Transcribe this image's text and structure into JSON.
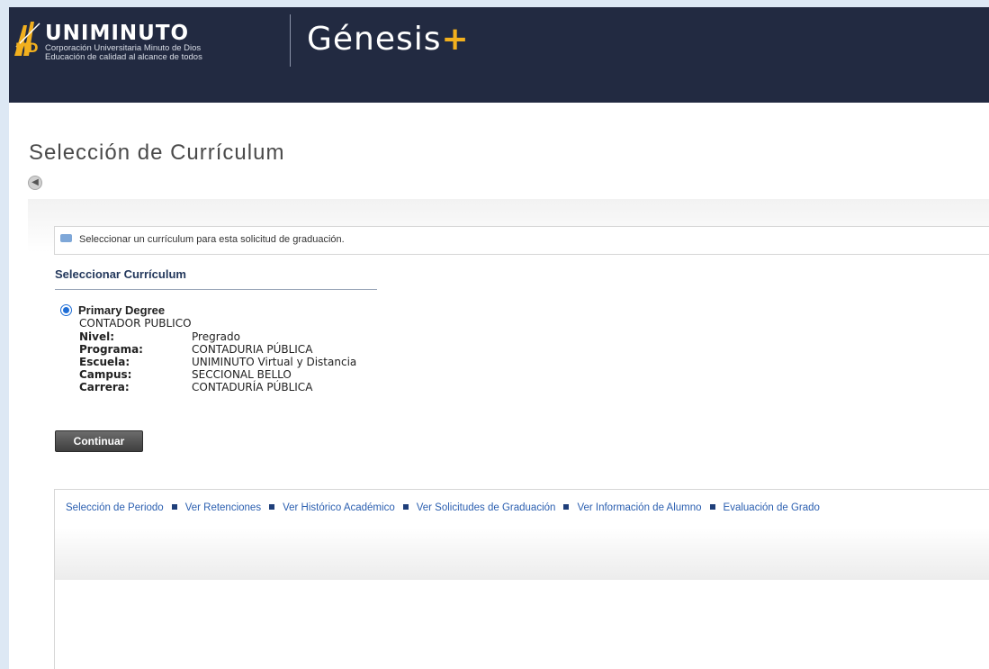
{
  "header": {
    "brand_name": "UNIMINUTO",
    "brand_tagline1": "Corporación Universitaria Minuto de Dios",
    "brand_tagline2": "Educación de calidad al alcance de todos",
    "logo_letters": "MD",
    "app_name": "Génesis",
    "app_suffix": "+",
    "colors": {
      "background": "#222a41",
      "accent": "#f2b01e"
    }
  },
  "page": {
    "title": "Selección de Currículum",
    "back_icon": "back-arrow-icon"
  },
  "info": {
    "icon": "message-icon",
    "text": "Seleccionar un currículum para esta solicitud de graduación."
  },
  "section": {
    "title": "Seleccionar Currículum"
  },
  "curriculum": {
    "selected": true,
    "title": "Primary Degree",
    "program_name": "CONTADOR PUBLICO",
    "details": [
      {
        "label": "Nivel:",
        "value": "Pregrado"
      },
      {
        "label": "Programa:",
        "value": "CONTADURIA PÚBLICA"
      },
      {
        "label": "Escuela:",
        "value": "UNIMINUTO Virtual y Distancia"
      },
      {
        "label": "Campus:",
        "value": "SECCIONAL BELLO"
      },
      {
        "label": "Carrera:",
        "value": "CONTADURÍA PÚBLICA"
      }
    ]
  },
  "actions": {
    "continue_label": "Continuar"
  },
  "nav": {
    "links": [
      "Selección de Periodo",
      "Ver Retenciones",
      "Ver Histórico Académico",
      "Ver Solicitudes de Graduación",
      "Ver Información de Alumno",
      "Evaluación de Grado"
    ]
  }
}
